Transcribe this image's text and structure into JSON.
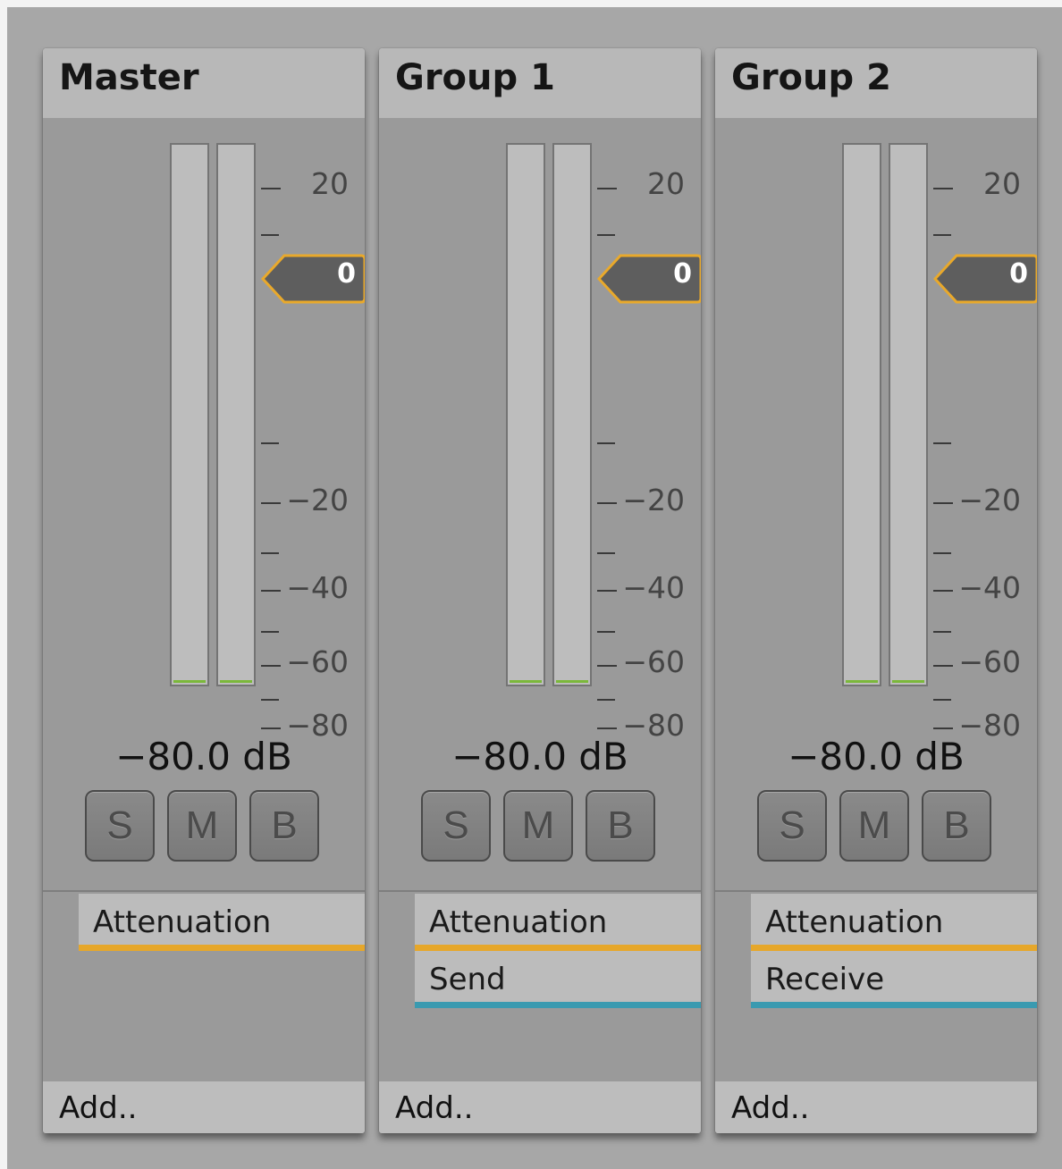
{
  "colors": {
    "attenuation": "#e6a72a",
    "routing": "#3a9ab0",
    "meter_level": "#7bb83a",
    "fader_outline": "#e9a92b"
  },
  "scale_labels": [
    "20",
    "−20",
    "−40",
    "−60",
    "−80"
  ],
  "strips": [
    {
      "title": "Master",
      "fader_value": "0",
      "db_readout": "−80.0 dB",
      "buttons": [
        "S",
        "M",
        "B"
      ],
      "effects": [
        {
          "label": "Attenuation",
          "type": "attenuation"
        }
      ],
      "add_label": "Add.."
    },
    {
      "title": "Group 1",
      "fader_value": "0",
      "db_readout": "−80.0 dB",
      "buttons": [
        "S",
        "M",
        "B"
      ],
      "effects": [
        {
          "label": "Attenuation",
          "type": "attenuation"
        },
        {
          "label": "Send",
          "type": "routing"
        }
      ],
      "add_label": "Add.."
    },
    {
      "title": "Group 2",
      "fader_value": "0",
      "db_readout": "−80.0 dB",
      "buttons": [
        "S",
        "M",
        "B"
      ],
      "effects": [
        {
          "label": "Attenuation",
          "type": "attenuation"
        },
        {
          "label": "Receive",
          "type": "routing"
        }
      ],
      "add_label": "Add.."
    }
  ]
}
